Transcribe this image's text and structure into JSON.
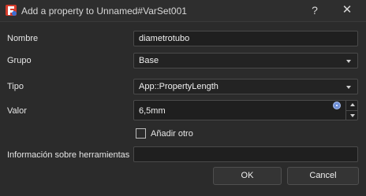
{
  "window": {
    "title": "Add a property to Unnamed#VarSet001",
    "help_label": "?",
    "close_label": "✕",
    "app_icon": "freecad-icon"
  },
  "form": {
    "name_label": "Nombre",
    "name_value": "diametrotubo",
    "group_label": "Grupo",
    "group_value": "Base",
    "type_label": "Tipo",
    "type_value": "App::PropertyLength",
    "value_label": "Valor",
    "value_value": "6,5mm",
    "add_another_label": "Añadir otro",
    "add_another_checked": false,
    "tooltip_label": "Información sobre herramientas",
    "tooltip_value": ""
  },
  "buttons": {
    "ok_label": "OK",
    "cancel_label": "Cancel"
  },
  "colors": {
    "background": "#2b2b2b",
    "field_background": "#1f1f1f",
    "icon_red": "#d43b2b",
    "icon_blue": "#3b6fd1"
  }
}
